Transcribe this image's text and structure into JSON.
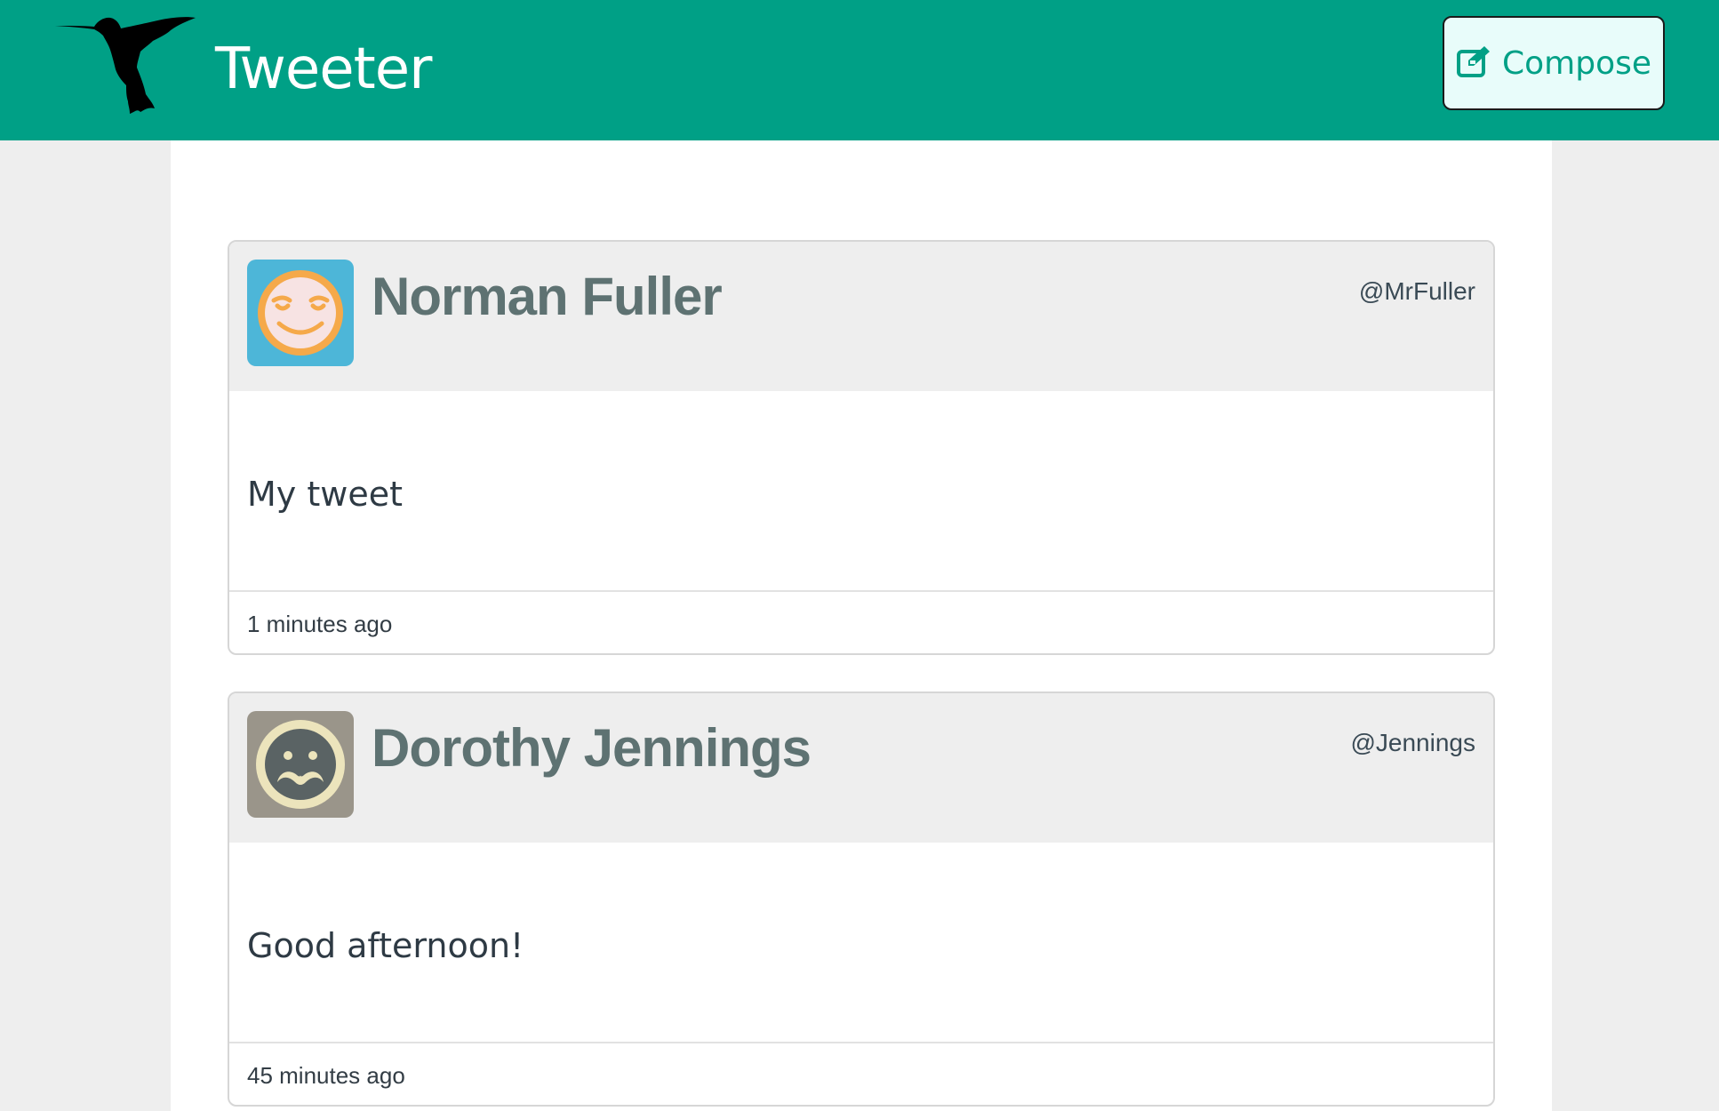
{
  "header": {
    "app_title": "Tweeter",
    "compose_label": "Compose",
    "background_color": "#00a086",
    "logo_icon": "hummingbird-logo-icon",
    "compose_icon": "edit-icon"
  },
  "tweets": [
    {
      "name": "Norman Fuller",
      "handle": "@MrFuller",
      "body": "My tweet",
      "time": "1 minutes ago",
      "avatar_icon": "smiling-face-avatar-icon"
    },
    {
      "name": "Dorothy Jennings",
      "handle": "@Jennings",
      "body": "Good afternoon!",
      "time": "45 minutes ago",
      "avatar_icon": "mustache-face-avatar-icon"
    }
  ]
}
